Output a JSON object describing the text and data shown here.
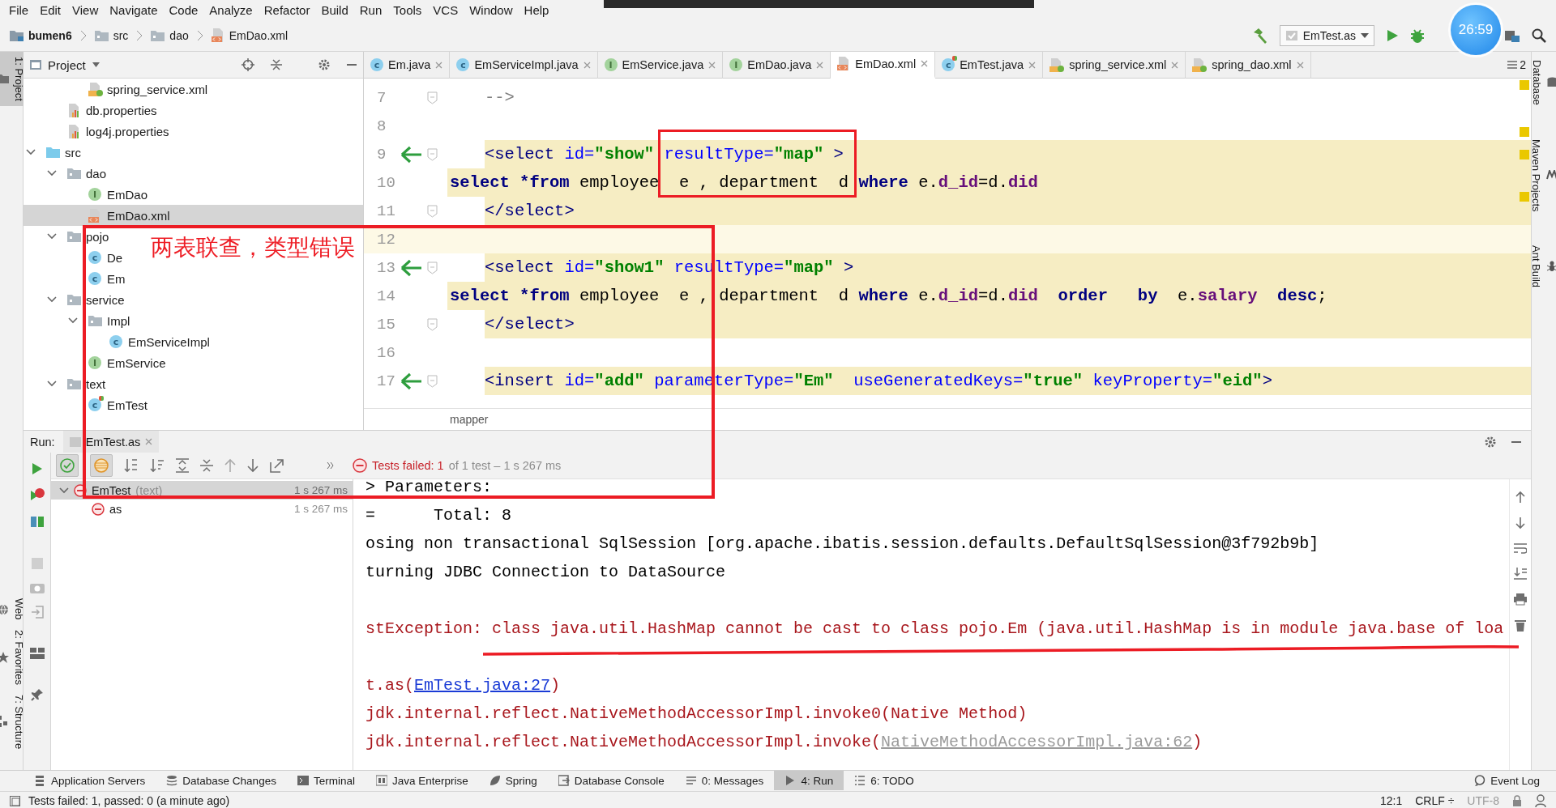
{
  "menu": [
    "File",
    "Edit",
    "View",
    "Navigate",
    "Code",
    "Analyze",
    "Refactor",
    "Build",
    "Run",
    "Tools",
    "VCS",
    "Window",
    "Help"
  ],
  "breadcrumb": [
    {
      "label": "bumen6",
      "kind": "module"
    },
    {
      "label": "src",
      "kind": "folder"
    },
    {
      "label": "dao",
      "kind": "folder"
    },
    {
      "label": "EmDao.xml",
      "kind": "xml"
    }
  ],
  "run_config": "EmTest.as",
  "timer": "26:59",
  "left_strip": [
    {
      "label": "1: Project",
      "selected": true
    },
    {
      "label": "Web",
      "selected": false
    },
    {
      "label": "2: Favorites",
      "selected": false
    },
    {
      "label": "7: Structure",
      "selected": false
    }
  ],
  "right_strip": [
    "Database",
    "Maven Projects",
    "Ant Build"
  ],
  "project_panel": {
    "title": "Project",
    "tree": [
      {
        "children": [
          {
            "children": [
              {
                "label": "spring_service.xml",
                "kind": "spring-xml",
                "selected": false
              }
            ]
          },
          {
            "label": "db.properties",
            "kind": "properties",
            "selected": false
          },
          {
            "label": "log4j.properties",
            "kind": "properties",
            "selected": false
          }
        ]
      },
      {
        "label": "src",
        "kind": "source-folder",
        "expanded": true,
        "selected": false,
        "children": [
          {
            "label": "dao",
            "kind": "folder",
            "expanded": true,
            "selected": false,
            "children": [
              {
                "label": "EmDao",
                "kind": "interface",
                "badge": "I",
                "selected": false
              },
              {
                "label": "EmDao.xml",
                "kind": "xml",
                "selected": true
              }
            ]
          },
          {
            "label": "pojo",
            "kind": "folder",
            "expanded": true,
            "selected": false,
            "children": [
              {
                "label": "De",
                "kind": "class",
                "badge": "c",
                "selected": false
              },
              {
                "label": "Em",
                "kind": "class",
                "badge": "c",
                "selected": false
              }
            ]
          },
          {
            "label": "service",
            "kind": "folder",
            "expanded": true,
            "selected": false,
            "children": [
              {
                "label": "Impl",
                "kind": "folder",
                "expanded": true,
                "selected": false,
                "children": [
                  {
                    "label": "EmServiceImpl",
                    "kind": "class",
                    "badge": "c",
                    "selected": false
                  }
                ]
              },
              {
                "label": "EmService",
                "kind": "interface",
                "badge": "I",
                "selected": false
              }
            ]
          },
          {
            "label": "text",
            "kind": "folder",
            "expanded": true,
            "selected": false,
            "children": [
              {
                "label": "EmTest",
                "kind": "test-class",
                "badge": "c",
                "selected": false
              }
            ]
          }
        ]
      }
    ]
  },
  "editor": {
    "tabs": [
      {
        "label": "Em.java",
        "kind": "class",
        "badge": "c",
        "selected": false
      },
      {
        "label": "EmServiceImpl.java",
        "kind": "class",
        "badge": "c",
        "selected": false
      },
      {
        "label": "EmService.java",
        "kind": "interface",
        "badge": "I",
        "selected": false
      },
      {
        "label": "EmDao.java",
        "kind": "interface",
        "badge": "I",
        "selected": false
      },
      {
        "label": "EmDao.xml",
        "kind": "xml",
        "selected": true
      },
      {
        "label": "EmTest.java",
        "kind": "test-class",
        "badge": "c",
        "selected": false
      },
      {
        "label": "spring_service.xml",
        "kind": "spring-xml",
        "selected": false
      },
      {
        "label": "spring_dao.xml",
        "kind": "spring-xml",
        "selected": false
      }
    ],
    "tab_count": "2",
    "lines": [
      {
        "number": "7",
        "indented": true,
        "highlighted": false,
        "current": false,
        "navigation": false,
        "foldable": true,
        "segments": [
          {
            "text": "-->",
            "kind": "comment"
          }
        ]
      },
      {
        "number": "8",
        "indented": false,
        "highlighted": false,
        "current": false,
        "navigation": false,
        "foldable": false
      },
      {
        "number": "9",
        "indented": true,
        "highlighted": true,
        "current": false,
        "navigation": true,
        "foldable": true,
        "segments": [
          {
            "text": "<select",
            "kind": "tag"
          },
          {
            "text": " id=",
            "kind": "attr"
          },
          {
            "text": "\"show\"",
            "kind": "value"
          },
          {
            "text": " resultType=",
            "kind": "attr"
          },
          {
            "text": "\"map\"",
            "kind": "value"
          },
          {
            "text": " >",
            "kind": "tag"
          }
        ]
      },
      {
        "number": "10",
        "indented": false,
        "highlighted": true,
        "current": false,
        "navigation": false,
        "foldable": false,
        "segments": [
          {
            "text": "select *from",
            "kind": "keyword"
          },
          {
            "text": " employee  e , department  d ",
            "kind": "plain"
          },
          {
            "text": "where",
            "kind": "keyword"
          },
          {
            "text": " e.",
            "kind": "plain"
          },
          {
            "text": "d_id",
            "kind": "column"
          },
          {
            "text": "=d.",
            "kind": "plain"
          },
          {
            "text": "did",
            "kind": "column"
          }
        ]
      },
      {
        "number": "11",
        "indented": true,
        "highlighted": true,
        "current": false,
        "navigation": false,
        "foldable": true,
        "segments": [
          {
            "text": "</select>",
            "kind": "tag"
          }
        ]
      },
      {
        "number": "12",
        "indented": false,
        "highlighted": false,
        "current": true,
        "navigation": false,
        "foldable": false
      },
      {
        "number": "13",
        "indented": true,
        "highlighted": true,
        "current": false,
        "navigation": true,
        "foldable": true,
        "segments": [
          {
            "text": "<select",
            "kind": "tag"
          },
          {
            "text": " id=",
            "kind": "attr"
          },
          {
            "text": "\"show1\"",
            "kind": "value"
          },
          {
            "text": " resultType=",
            "kind": "attr"
          },
          {
            "text": "\"map\"",
            "kind": "value"
          },
          {
            "text": " >",
            "kind": "tag"
          }
        ]
      },
      {
        "number": "14",
        "indented": false,
        "highlighted": true,
        "current": false,
        "navigation": false,
        "foldable": false,
        "segments": [
          {
            "text": "select *from",
            "kind": "keyword"
          },
          {
            "text": " employee  e , department  d ",
            "kind": "plain"
          },
          {
            "text": "where",
            "kind": "keyword"
          },
          {
            "text": " e.",
            "kind": "plain"
          },
          {
            "text": "d_id",
            "kind": "column"
          },
          {
            "text": "=d.",
            "kind": "plain"
          },
          {
            "text": "did",
            "kind": "column"
          },
          {
            "text": "  order   by",
            "kind": "keyword"
          },
          {
            "text": "  e.",
            "kind": "plain"
          },
          {
            "text": "salary",
            "kind": "column"
          },
          {
            "text": "  desc",
            "kind": "keyword"
          },
          {
            "text": ";",
            "kind": "plain"
          }
        ]
      },
      {
        "number": "15",
        "indented": true,
        "highlighted": true,
        "current": false,
        "navigation": false,
        "foldable": true,
        "segments": [
          {
            "text": "</select>",
            "kind": "tag"
          }
        ]
      },
      {
        "number": "16",
        "indented": false,
        "highlighted": false,
        "current": false,
        "navigation": false,
        "foldable": false
      },
      {
        "number": "17",
        "indented": true,
        "highlighted": true,
        "current": false,
        "navigation": true,
        "foldable": true,
        "segments": [
          {
            "text": "<insert",
            "kind": "tag"
          },
          {
            "text": " id=",
            "kind": "attr"
          },
          {
            "text": "\"add\"",
            "kind": "value"
          },
          {
            "text": " parameterType=",
            "kind": "attr"
          },
          {
            "text": "\"Em\"",
            "kind": "value"
          },
          {
            "text": "  useGeneratedKeys=",
            "kind": "attr"
          },
          {
            "text": "\"true\"",
            "kind": "value"
          },
          {
            "text": " keyProperty=",
            "kind": "attr"
          },
          {
            "text": "\"eid\"",
            "kind": "value"
          },
          {
            "text": ">",
            "kind": "tag"
          }
        ]
      }
    ],
    "breadcrumb": "mapper"
  },
  "run": {
    "label": "Run:",
    "tab": "EmTest.as",
    "status": "Tests failed: 1",
    "status_detail": "of 1 test – 1 s 267 ms",
    "tests": [
      {
        "label": "EmTest",
        "detail": "(text)",
        "time": "1 s 267 ms",
        "failed": true,
        "expanded": true,
        "selected": true,
        "children": [
          {
            "label": "as",
            "time": "1 s 267 ms",
            "failed": true,
            "selected": false
          }
        ]
      }
    ],
    "console": [
      {
        "kind": "output",
        "segments": [
          {
            "text": "> Parameters:",
            "kind": "plain"
          }
        ]
      },
      {
        "kind": "output",
        "segments": [
          {
            "text": "=      Total: 8",
            "kind": "plain"
          }
        ]
      },
      {
        "kind": "output",
        "segments": [
          {
            "text": "osing non transactional SqlSession [org.apache.ibatis.session.defaults.DefaultSqlSession@3f792b9b]",
            "kind": "plain"
          }
        ]
      },
      {
        "kind": "output",
        "segments": [
          {
            "text": "turning JDBC Connection to DataSource",
            "kind": "plain"
          }
        ]
      },
      {
        "kind": "blank"
      },
      {
        "kind": "error",
        "segments": [
          {
            "text": "stException: class java.util.HashMap cannot be cast to class pojo.Em (java.util.HashMap is in module java.base of loa",
            "kind": "plain"
          }
        ]
      },
      {
        "kind": "blank"
      },
      {
        "kind": "error",
        "segments": [
          {
            "text": "t.as(",
            "kind": "plain"
          },
          {
            "text": "EmTest.java:27",
            "kind": "link"
          },
          {
            "text": ")",
            "kind": "plain"
          }
        ]
      },
      {
        "kind": "error",
        "segments": [
          {
            "text": "jdk.internal.reflect.NativeMethodAccessorImpl.invoke0(Native Method)",
            "kind": "plain"
          }
        ]
      },
      {
        "kind": "error",
        "segments": [
          {
            "text": "jdk.internal.reflect.NativeMethodAccessorImpl.invoke(",
            "kind": "plain"
          },
          {
            "text": "NativeMethodAccessorImpl.java:62",
            "kind": "library-link"
          },
          {
            "text": ")",
            "kind": "plain"
          }
        ]
      }
    ]
  },
  "tool_windows": [
    {
      "label": "Application Servers",
      "selected": false
    },
    {
      "label": "Database Changes",
      "selected": false
    },
    {
      "label": "Terminal",
      "selected": false
    },
    {
      "label": "Java Enterprise",
      "selected": false
    },
    {
      "label": "Spring",
      "selected": false
    },
    {
      "label": "Database Console",
      "selected": false
    },
    {
      "label": "0: Messages",
      "selected": false
    },
    {
      "label": "4: Run",
      "selected": true
    },
    {
      "label": "6: TODO",
      "selected": false
    }
  ],
  "event_log": "Event Log",
  "status_bar": {
    "message": "Tests failed: 1, passed: 0 (a minute ago)",
    "position": "12:1",
    "line_separator": "CRLF ÷",
    "encoding": "UTF-8"
  },
  "annotations": [
    {
      "kind": "box"
    },
    {
      "kind": "box"
    },
    {
      "kind": "text",
      "text": "两表联查，类型错误"
    },
    {
      "kind": "underline"
    }
  ]
}
